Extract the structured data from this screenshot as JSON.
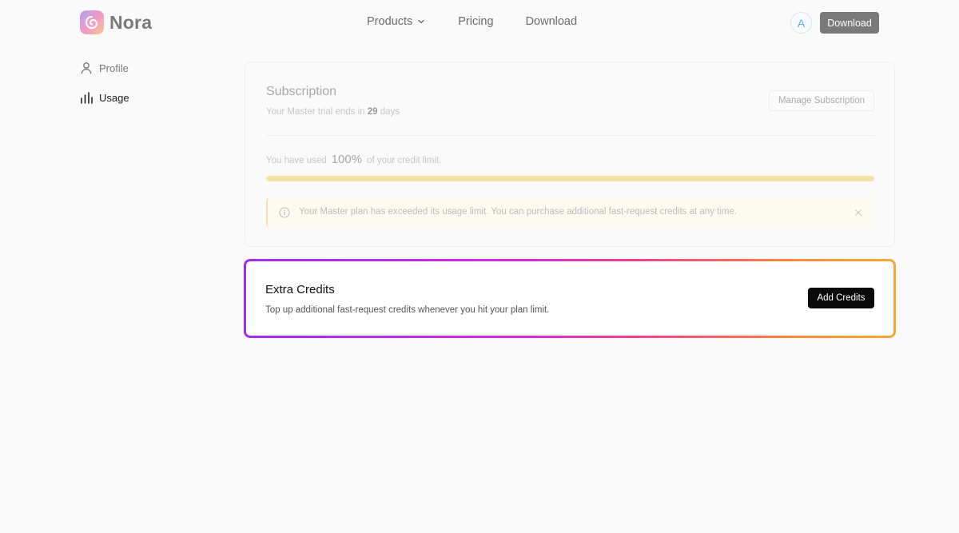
{
  "brand": {
    "name": "Nora"
  },
  "nav": {
    "products_label": "Products",
    "pricing_label": "Pricing",
    "download_label": "Download"
  },
  "header": {
    "avatar_initial": "A",
    "download_button": "Download"
  },
  "sidebar": {
    "items": [
      {
        "label": "Profile",
        "icon": "user-icon"
      },
      {
        "label": "Usage",
        "icon": "bar-chart-icon",
        "active": true
      }
    ]
  },
  "subscription": {
    "title": "Subscription",
    "trial_prefix": "Your Master trial ends in ",
    "trial_days": "29",
    "trial_suffix": " days",
    "manage_button": "Manage Subscription",
    "usage_prefix": "You have used",
    "usage_percent": "100%",
    "usage_suffix": "of your credit limit.",
    "usage_fraction": 1.0,
    "alert_text": "Your Master plan has exceeded its usage limit. You can purchase additional fast-request credits at any time."
  },
  "extra_credits": {
    "title": "Extra Credits",
    "description": "Top up additional fast-request credits whenever you hit your plan limit.",
    "button": "Add Credits"
  },
  "colors": {
    "progress_fill": "#f5e2a8",
    "gradient_start": "#a32cf0",
    "gradient_end": "#f6a93a",
    "primary_button": "#0a0a0a"
  }
}
